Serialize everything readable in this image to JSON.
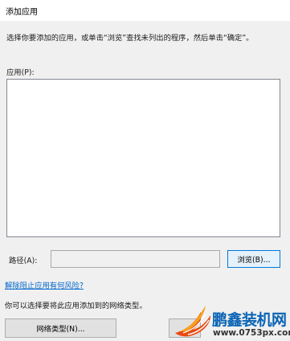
{
  "window": {
    "title": "添加应用"
  },
  "instruction": "选择你要添加的应用，或单击“浏览”查找未列出的程序，然后单击“确定”。",
  "apps": {
    "label": "应用(P):",
    "items": []
  },
  "path": {
    "label": "路径(A):",
    "value": "",
    "browse_label": "浏览(B)..."
  },
  "risk_link": "解除阻止应用有何风险?",
  "network": {
    "note": "你可以选择要将此应用添加到的网络类型。",
    "button_label": "网络类型(N)..."
  },
  "watermark": {
    "brand": "鹏鑫装机网",
    "url": "www.0753px.com"
  },
  "colors": {
    "link": "#0066cc",
    "accent_border": "#0078d7",
    "watermark_blue": "#0a64b4"
  }
}
